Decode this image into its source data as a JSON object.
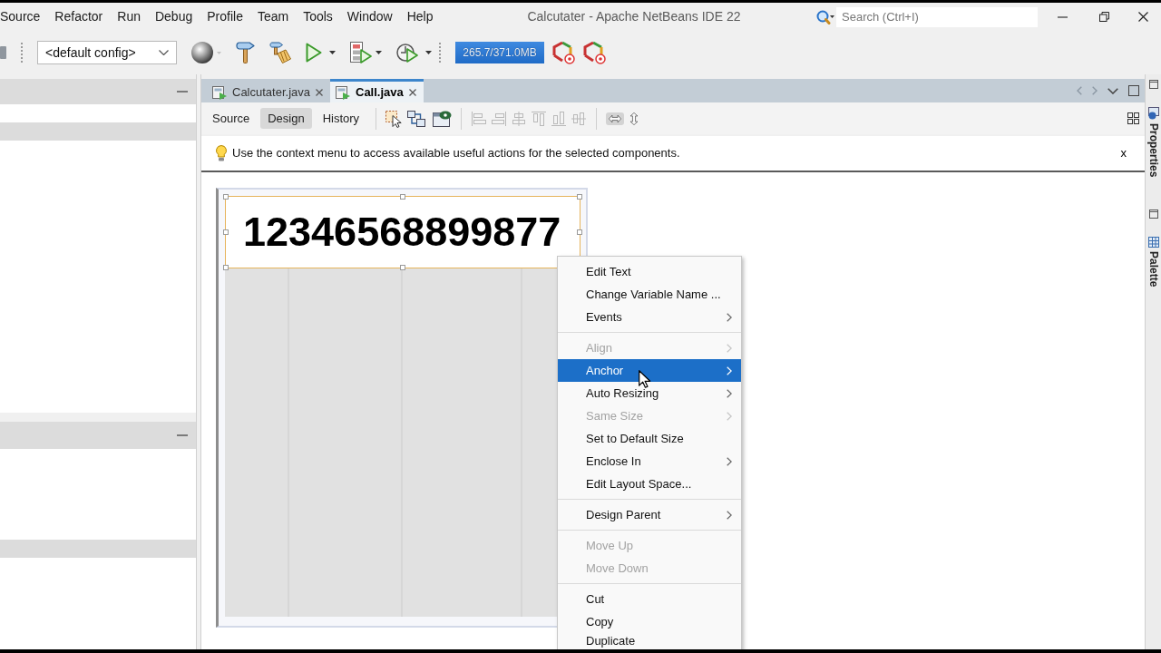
{
  "menu_bar": [
    "Source",
    "Refactor",
    "Run",
    "Debug",
    "Profile",
    "Team",
    "Tools",
    "Window",
    "Help"
  ],
  "window": {
    "title": "Calcutater - Apache NetBeans IDE 22"
  },
  "search": {
    "placeholder": "Search (Ctrl+I)"
  },
  "toolbar": {
    "config": "<default config>",
    "memory": "265.7/371.0MB"
  },
  "editor_tabs": [
    {
      "label": "Calcutater.java",
      "selected": false
    },
    {
      "label": "Call.java",
      "selected": true
    }
  ],
  "view_buttons": [
    {
      "label": "Source",
      "selected": false
    },
    {
      "label": "Design",
      "selected": true
    },
    {
      "label": "History",
      "selected": false
    }
  ],
  "designer_toolbar": {
    "align_tools": {
      "disabled": true
    },
    "resize_tools": [
      {
        "kind": "horizontal",
        "selected": true
      },
      {
        "kind": "vertical",
        "selected": false
      }
    ]
  },
  "hint": {
    "text": "Use the context menu to access available useful actions for the selected components.",
    "close": "x"
  },
  "form": {
    "label_text": "12346568899877",
    "selected": true
  },
  "context_menu": {
    "groups": [
      [
        {
          "label": "Edit Text",
          "submenu": false,
          "disabled": false,
          "selected": false
        },
        {
          "label": "Change Variable Name ...",
          "submenu": false,
          "disabled": false,
          "selected": false
        },
        {
          "label": "Events",
          "submenu": true,
          "disabled": false,
          "selected": false
        }
      ],
      [
        {
          "label": "Align",
          "submenu": true,
          "disabled": true,
          "selected": false
        },
        {
          "label": "Anchor",
          "submenu": true,
          "disabled": false,
          "selected": true
        },
        {
          "label": "Auto Resizing",
          "submenu": true,
          "disabled": false,
          "selected": false
        },
        {
          "label": "Same Size",
          "submenu": true,
          "disabled": true,
          "selected": false
        },
        {
          "label": "Set to Default Size",
          "submenu": false,
          "disabled": false,
          "selected": false
        },
        {
          "label": "Enclose In",
          "submenu": true,
          "disabled": false,
          "selected": false
        },
        {
          "label": "Edit Layout Space...",
          "submenu": false,
          "disabled": false,
          "selected": false
        }
      ],
      [
        {
          "label": "Design Parent",
          "submenu": true,
          "disabled": false,
          "selected": false
        }
      ],
      [
        {
          "label": "Move Up",
          "submenu": false,
          "disabled": true,
          "selected": false
        },
        {
          "label": "Move Down",
          "submenu": false,
          "disabled": true,
          "selected": false
        }
      ],
      [
        {
          "label": "Cut",
          "submenu": false,
          "disabled": false,
          "selected": false
        },
        {
          "label": "Copy",
          "submenu": false,
          "disabled": false,
          "selected": false
        },
        {
          "label": "Duplicate",
          "submenu": false,
          "disabled": false,
          "selected": false
        }
      ]
    ]
  },
  "side_tabs": [
    {
      "kind": "properties",
      "label": "Properties"
    },
    {
      "kind": "palette",
      "label": "Palette"
    }
  ]
}
